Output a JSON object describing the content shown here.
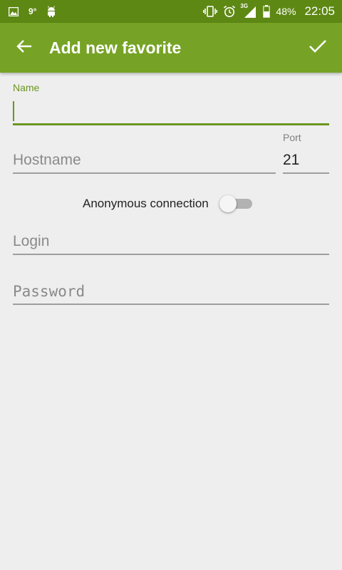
{
  "status_bar": {
    "icons": [
      "image-icon",
      "weather-icon",
      "android-icon",
      "vibrate-icon",
      "alarm-icon",
      "signal-3g-icon",
      "battery-icon"
    ],
    "temperature": "9°",
    "network": "3G",
    "battery_percent": "48%",
    "time": "22:05"
  },
  "app_bar": {
    "title": "Add new favorite",
    "back_icon": "arrow-left-icon",
    "confirm_icon": "check-icon"
  },
  "form": {
    "name": {
      "label": "Name",
      "value": "",
      "focused": true
    },
    "hostname": {
      "placeholder": "Hostname",
      "value": ""
    },
    "port": {
      "label": "Port",
      "value": "21"
    },
    "anonymous": {
      "label": "Anonymous connection",
      "enabled": false
    },
    "login": {
      "placeholder": "Login",
      "value": ""
    },
    "password": {
      "placeholder": "Password",
      "value": ""
    }
  },
  "colors": {
    "status_bar": "#5e8814",
    "app_bar": "#76a325",
    "accent": "#6a951f",
    "background": "#eeeeee"
  }
}
